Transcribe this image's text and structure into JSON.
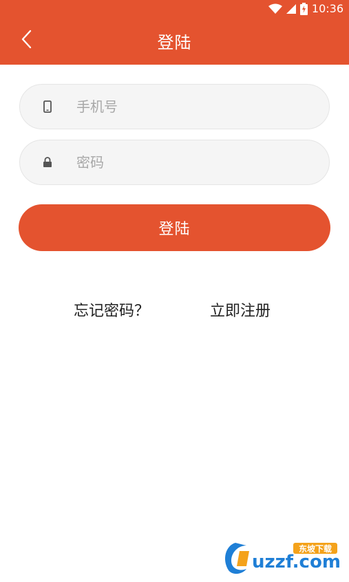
{
  "status_bar": {
    "time": "10:36",
    "icons": [
      "wifi-icon",
      "signal-icon",
      "battery-charging-icon"
    ]
  },
  "app_bar": {
    "title": "登陆",
    "back_icon": "chevron-left-icon"
  },
  "form": {
    "phone": {
      "placeholder": "手机号",
      "value": "",
      "icon": "phone-icon"
    },
    "password": {
      "placeholder": "密码",
      "value": "",
      "icon": "lock-icon"
    },
    "login_label": "登陆"
  },
  "links": {
    "forgot_password": "忘记密码？",
    "register": "立即注册"
  },
  "watermark": {
    "brand": "uzzf.com",
    "tagline": "东坡下载"
  },
  "colors": {
    "primary": "#e4532f",
    "field_bg": "#f5f5f5",
    "placeholder": "#a8a8a8"
  }
}
